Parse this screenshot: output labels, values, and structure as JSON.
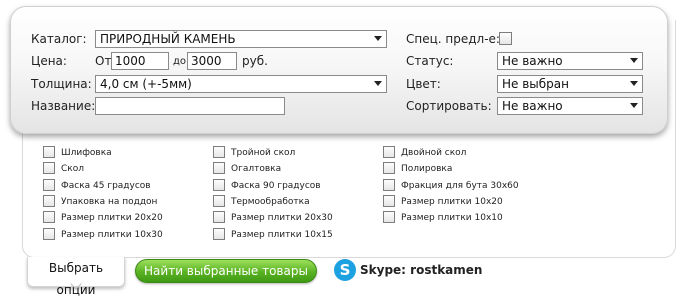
{
  "filters": {
    "catalog_label": "Каталог:",
    "catalog_value": "ПРИРОДНЫЙ КАМЕНЬ",
    "price_label": "Цена:",
    "price_from_label": "От",
    "price_from_value": "1000",
    "price_to_label": "до",
    "price_to_value": "3000",
    "price_unit": "руб.",
    "thickness_label": "Толщина:",
    "thickness_value": "4,0 см (+-5мм)",
    "name_label": "Название:",
    "name_value": "",
    "special_label": "Спец. предл-е:",
    "status_label": "Статус:",
    "status_value": "Не важно",
    "color_label": "Цвет:",
    "color_value": "Не выбран",
    "sort_label": "Сортировать:",
    "sort_value": "Не важно"
  },
  "options": {
    "col1": [
      "Шлифовка",
      "Скол",
      "Фаска 45 градусов",
      "Упаковка на поддон",
      "Размер плитки 20х20",
      "Размер плитки 10х30"
    ],
    "col2": [
      "Тройной скол",
      "Огалтовка",
      "Фаска 90 градусов",
      "Термообработка",
      "Размер плитки 20х30",
      "Размер плитки 10х15"
    ],
    "col3": [
      "Двойной скол",
      "Полировка",
      "Фракция для бута 30х60",
      "Размер плитки 10х20",
      "Размер плитки 10х10"
    ]
  },
  "footer": {
    "options_tab_label": "Выбрать опции",
    "find_button_label": "Найти выбранные товары",
    "skype_icon_glyph": "S",
    "skype_label": "Skype: rostkamen"
  }
}
